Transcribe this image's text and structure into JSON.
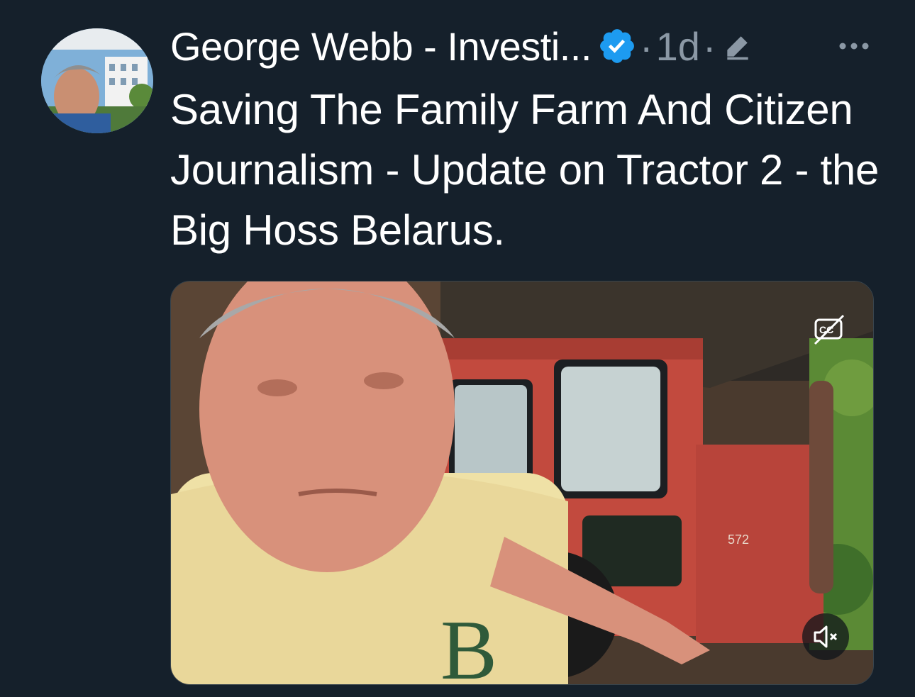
{
  "tweet": {
    "author_name": "George Webb - Investi...",
    "separator": "·",
    "time": "1d",
    "text": "Saving The Family Farm And Citizen Journalism - Update on Tractor 2 - the Big Hoss Belarus.",
    "verified": true
  },
  "icons": {
    "verified": "verified-badge-icon",
    "edit": "pencil-icon",
    "more": "more-horizontal-icon",
    "captions": "closed-captions-off-icon",
    "mute": "volume-muted-icon"
  },
  "media": {
    "type": "video",
    "tractor_number": "572",
    "shirt_letters": "B"
  },
  "colors": {
    "background": "#15202b",
    "primary_text": "#ffffff",
    "secondary_text": "#8b98a5",
    "verified_blue": "#1d9bf0"
  }
}
